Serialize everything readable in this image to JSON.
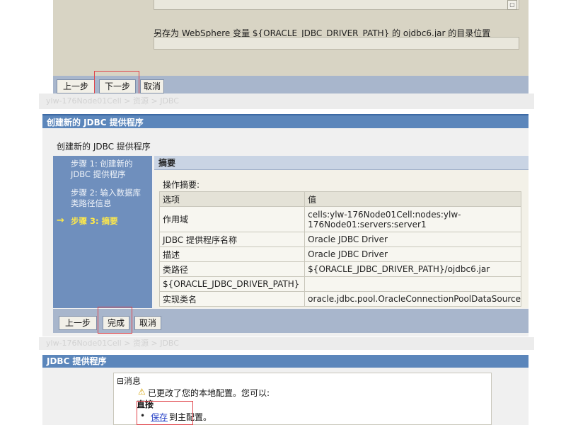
{
  "panel1": {
    "scroll_glyph": "▢",
    "description": "另存为 WebSphere 变量 ${ORACLE_JDBC_DRIVER_PATH} 的 ojdbc6.jar 的目录位置",
    "buttons": {
      "previous": "上一步",
      "next": "下一步",
      "cancel": "取消"
    },
    "breadcrumb_faded": "ylw-176Node01Cell > 资源 > JDBC"
  },
  "panel2": {
    "title": "创建新的 JDBC 提供程序",
    "heading": "创建新的 JDBC 提供程序",
    "steps": [
      {
        "label": "步骤 1: 创建新的 JDBC 提供程序"
      },
      {
        "label": "步骤 2: 输入数据库类路径信息"
      },
      {
        "label": "步骤 3: 摘要"
      }
    ],
    "active_arrow": "→",
    "summary_title": "摘要",
    "operation_label": "操作摘要:",
    "table": {
      "headers": [
        "选项",
        "值"
      ],
      "rows": [
        {
          "option": "作用域",
          "value": "cells:ylw-176Node01Cell:nodes:ylw-176Node01:servers:server1"
        },
        {
          "option": "JDBC 提供程序名称",
          "value": "Oracle JDBC Driver"
        },
        {
          "option": "描述",
          "value": "Oracle JDBC Driver"
        },
        {
          "option": "类路径",
          "value": "${ORACLE_JDBC_DRIVER_PATH}/ojdbc6.jar"
        },
        {
          "option": "${ORACLE_JDBC_DRIVER_PATH}",
          "value": ""
        },
        {
          "option": "实现类名",
          "value": "oracle.jdbc.pool.OracleConnectionPoolDataSource"
        }
      ]
    },
    "buttons": {
      "previous": "上一步",
      "finish": "完成",
      "cancel": "取消"
    },
    "breadcrumb_faded": "ylw-176Node01Cell > 资源 > JDBC"
  },
  "panel3": {
    "title": "JDBC 提供程序",
    "message_toggle": "⊟消息",
    "warning_icon": "⚠",
    "message_text": "已更改了您的本地配置。您可以:",
    "direct_label": "直接",
    "bullet": "•",
    "save_link": "保存",
    "save_suffix": "到主配置。"
  },
  "colors": {
    "title_bar": "#5b86bb",
    "button_bar": "#a8b6cc",
    "step_sidebar": "#6f8fbd",
    "active_step": "#ffe94a",
    "highlight": "#e0454b",
    "link": "#2a45c7"
  }
}
